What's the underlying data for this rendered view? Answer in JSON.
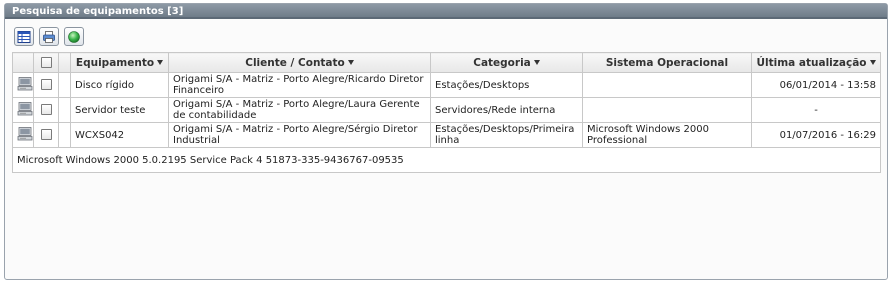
{
  "panel": {
    "title": "Pesquisa de equipamentos [3]"
  },
  "toolbar": {
    "buttons": [
      {
        "icon": "table-view-icon"
      },
      {
        "icon": "printer-icon"
      },
      {
        "icon": "refresh-globe-icon"
      }
    ]
  },
  "table": {
    "columns": {
      "equipamento": "Equipamento",
      "cliente": "Cliente / Contato",
      "categoria": "Categoria",
      "sistema": "Sistema Operacional",
      "atualizacao": "Última atualização"
    },
    "rows": [
      {
        "icon": "computer-icon",
        "equipamento": "Disco rígido",
        "cliente": "Origami S/A - Matriz - Porto Alegre/Ricardo Diretor Financeiro",
        "categoria": "Estações/Desktops",
        "sistema": "",
        "atualizacao": "06/01/2014 - 13:58"
      },
      {
        "icon": "computer-icon",
        "equipamento": "Servidor teste",
        "cliente": "Origami S/A - Matriz - Porto Alegre/Laura Gerente de contabilidade",
        "categoria": "Servidores/Rede interna",
        "sistema": "",
        "atualizacao": "-"
      },
      {
        "icon": "computer-icon",
        "equipamento": "WCXS042",
        "cliente": "Origami S/A - Matriz - Porto Alegre/Sérgio Diretor Industrial",
        "categoria": "Estações/Desktops/Primeira linha",
        "sistema": "Microsoft Windows 2000 Professional",
        "atualizacao": "01/07/2016 - 16:29"
      }
    ],
    "detail": "Microsoft Windows 2000 5.0.2195 Service Pack 4 51873-335-9436767-09535"
  }
}
